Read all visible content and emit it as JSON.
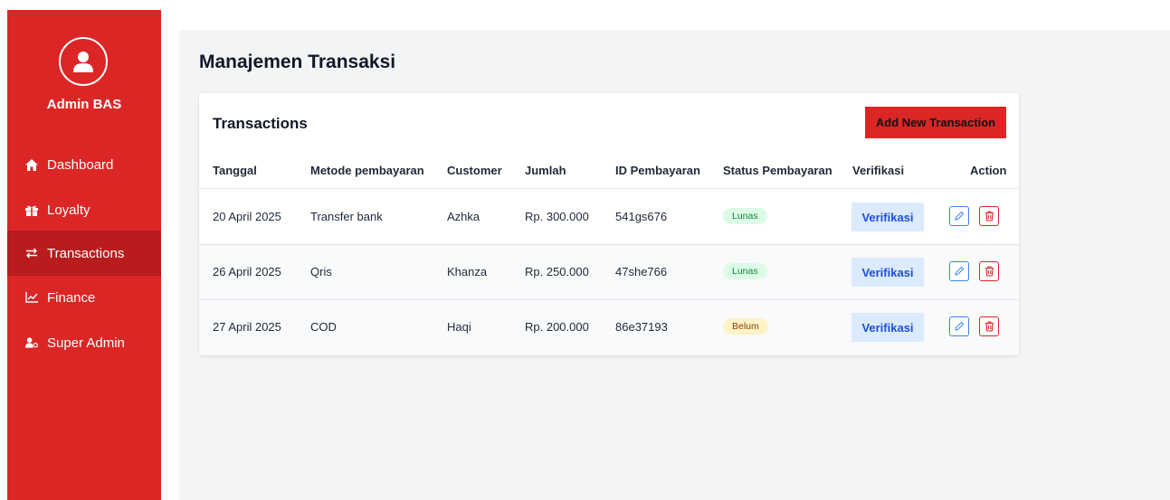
{
  "sidebar": {
    "admin_name": "Admin BAS",
    "items": [
      {
        "label": "Dashboard",
        "icon": "home-icon"
      },
      {
        "label": "Loyalty",
        "icon": "gift-icon"
      },
      {
        "label": "Transactions",
        "icon": "arrows-exchange-icon",
        "active": true
      },
      {
        "label": "Finance",
        "icon": "chart-line-icon"
      },
      {
        "label": "Super Admin",
        "icon": "user-cog-icon"
      }
    ]
  },
  "main": {
    "page_title": "Manajemen Transaksi",
    "card": {
      "title": "Transactions",
      "add_button": "Add New Transaction",
      "columns": [
        "Tanggal",
        "Metode pembayaran",
        "Customer",
        "Jumlah",
        "ID Pembayaran",
        "Status Pembayaran",
        "Verifikasi",
        "Action"
      ],
      "rows": [
        {
          "tanggal": "20 April 2025",
          "metode": "Transfer bank",
          "customer": "Azhka",
          "jumlah": "Rp. 300.000",
          "id": "541gs676",
          "status": "Lunas",
          "verifikasi": "Verifikasi"
        },
        {
          "tanggal": "26 April 2025",
          "metode": "Qris",
          "customer": "Khanza",
          "jumlah": "Rp. 250.000",
          "id": "47she766",
          "status": "Lunas",
          "verifikasi": "Verifikasi"
        },
        {
          "tanggal": "27 April 2025",
          "metode": "COD",
          "customer": "Haqi",
          "jumlah": "Rp. 200.000",
          "id": "86e37193",
          "status": "Belum",
          "verifikasi": "Verifikasi"
        }
      ]
    }
  },
  "colors": {
    "primary": "#dc2626",
    "sidebar_active": "#b91c1c",
    "verify_bg": "#dbeafe",
    "verify_text": "#1d4ed8",
    "lunas_bg": "#dcfce7",
    "belum_bg": "#fef3c7"
  }
}
